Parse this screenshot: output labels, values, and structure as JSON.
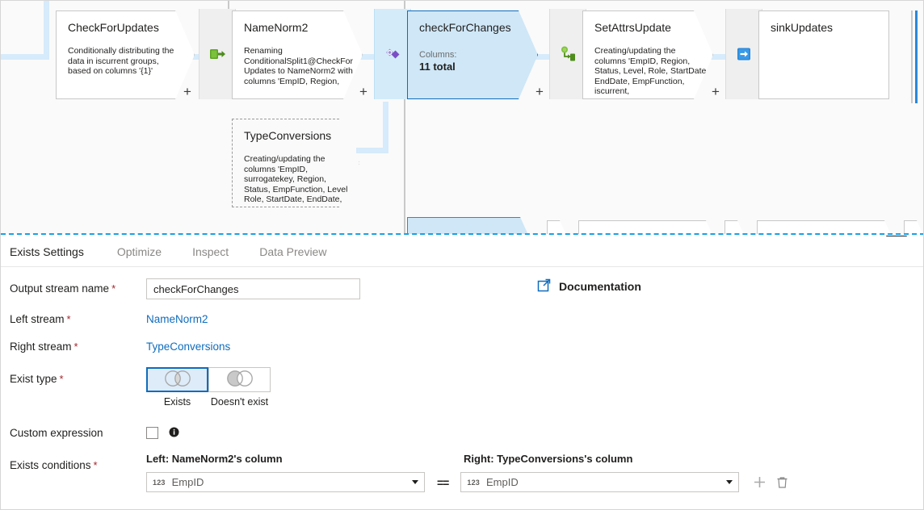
{
  "canvas": {
    "nodes": [
      {
        "name": "CheckForUpdates",
        "desc": "Conditionally distributing the data in iscurrent groups, based on columns '{1}'"
      },
      {
        "name": "NameNorm2",
        "desc": "Renaming ConditionalSplit1@CheckForUpdates to NameNorm2 with columns 'EmpID, Region,"
      },
      {
        "name": "checkForChanges",
        "columns_label": "Columns:",
        "columns_value": "11 total"
      },
      {
        "name": "SetAttrsUpdate",
        "desc": "Creating/updating the columns 'EmpID, Region, Status, Level, Role, StartDate, EndDate, EmpFunction, iscurrent,"
      },
      {
        "name": "sinkUpdates"
      },
      {
        "name": "TypeConversions",
        "desc": "Creating/updating the columns 'EmpID, surrogatekey, Region, Status, EmpFunction, Level, Role, StartDate, EndDate,"
      }
    ],
    "plus_label": "+",
    "connector_icons": [
      "select-transform-icon",
      "exists-transform-icon",
      "derived-column-transform-icon",
      "sink-transform-icon"
    ]
  },
  "panel": {
    "tabs": [
      {
        "label": "Exists Settings",
        "active": true
      },
      {
        "label": "Optimize",
        "active": false
      },
      {
        "label": "Inspect",
        "active": false
      },
      {
        "label": "Data Preview",
        "active": false
      }
    ],
    "form": {
      "output_stream_name": {
        "label": "Output stream name",
        "required": "*",
        "value": "checkForChanges"
      },
      "documentation": {
        "label": "Documentation",
        "icon": "external-link-icon"
      },
      "left_stream": {
        "label": "Left stream",
        "required": "*",
        "value": "NameNorm2"
      },
      "right_stream": {
        "label": "Right stream",
        "required": "*",
        "value": "TypeConversions"
      },
      "exist_type": {
        "label": "Exist type",
        "required": "*",
        "options": [
          {
            "label": "Exists",
            "selected": true,
            "icon": "venn-intersection-icon"
          },
          {
            "label": "Doesn't exist",
            "selected": false,
            "icon": "venn-left-only-icon"
          }
        ]
      },
      "custom_expression": {
        "label": "Custom expression",
        "checked": false,
        "info_icon": "info-icon"
      },
      "exists_conditions": {
        "label": "Exists conditions",
        "required": "*",
        "left_header": "Left: NameNorm2's column",
        "right_header": "Right: TypeConversions's column",
        "operator": "==",
        "rows": [
          {
            "left_type": "123",
            "left_value": "EmpID",
            "right_type": "123",
            "right_value": "EmpID"
          }
        ],
        "add_label": "add-condition",
        "delete_label": "delete-condition"
      }
    }
  },
  "colors": {
    "accent": "#0f6cbd",
    "selected_node_fill": "#cfe7f7",
    "edge": "#d6ebfb",
    "required_asterisk": "#a4262c",
    "splitter": "#19a1e6"
  }
}
